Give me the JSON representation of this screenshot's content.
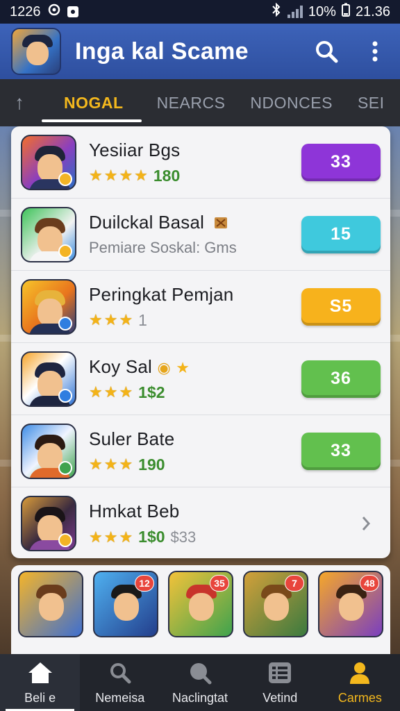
{
  "status_bar": {
    "time": "1226",
    "battery": "10%",
    "clock": "21.36"
  },
  "app_bar": {
    "title": "Inga kal Scame"
  },
  "tabs": [
    {
      "label": "NOGAL",
      "active": true
    },
    {
      "label": "NEARCS",
      "active": false
    },
    {
      "label": "NDONCES",
      "active": false
    },
    {
      "label": "SEI",
      "active": false
    }
  ],
  "list": [
    {
      "title": "Yesiiar Bgs",
      "stars": "★★★★",
      "rating": "180",
      "button": "33",
      "button_color": "#8e35d8"
    },
    {
      "title": "Duilckal Basal",
      "subtitle": "Pemiare Soskal: Gms",
      "button": "15",
      "button_color": "#3fc9dd"
    },
    {
      "title": "Peringkat Pemjan",
      "stars": "★★★",
      "rating": "1",
      "button": "S5",
      "button_color": "#f7b21c"
    },
    {
      "title": "Koy Sal",
      "stars": "★★★",
      "rating": "1$2",
      "button": "36",
      "button_color": "#62c04e"
    },
    {
      "title": "Suler Bate",
      "stars": "★★★",
      "rating": "190",
      "button": "33",
      "button_color": "#62c04e"
    },
    {
      "title": "Hmkat Beb",
      "stars": "★★★",
      "rating": "1$0",
      "extra": "$33"
    }
  ],
  "grid": [
    {
      "badge": ""
    },
    {
      "badge": "12"
    },
    {
      "badge": "35"
    },
    {
      "badge": "7"
    },
    {
      "badge": "48"
    }
  ],
  "bottom_nav": [
    {
      "label": "Beli e",
      "icon": "home-icon"
    },
    {
      "label": "Nemeisa",
      "icon": "search-icon"
    },
    {
      "label": "Naclingtat",
      "icon": "search-icon"
    },
    {
      "label": "Vetind",
      "icon": "list-icon"
    },
    {
      "label": "Carmes",
      "icon": "person-icon"
    }
  ],
  "colors": {
    "accent": "#f4b81d",
    "app_bar": "#3d63b9",
    "nav_bg": "#22252c"
  }
}
